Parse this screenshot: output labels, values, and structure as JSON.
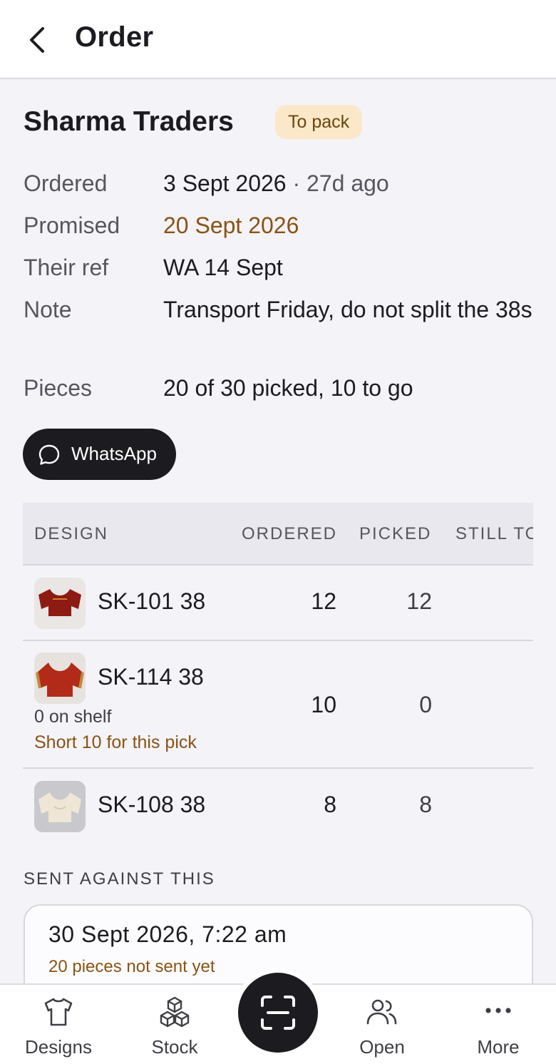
{
  "header": {
    "title": "Order"
  },
  "order": {
    "customer": "Sharma Traders",
    "status": "To pack",
    "ordered_label": "Ordered",
    "ordered_date": "3 Sept 2026",
    "ordered_ago": "· 27d ago",
    "promised_label": "Promised",
    "promised_date": "20 Sept 2026",
    "ref_label": "Their ref",
    "ref_value": "WA 14 Sept",
    "note_label": "Note",
    "note_value": "Transport Friday, do not split the 38s",
    "pieces_label": "Pieces",
    "pieces_value": "20 of 30 picked, 10 to go",
    "whatsapp_label": "WhatsApp"
  },
  "table": {
    "headers": [
      "DESIGN",
      "ORDERED",
      "PICKED",
      "STILL TO"
    ],
    "rows": [
      {
        "design": "SK-101 38",
        "ordered": "12",
        "picked": "12",
        "thumb_color": "#8e1a14"
      },
      {
        "design": "SK-114 38",
        "ordered": "10",
        "picked": "0",
        "shelf": "0 on shelf",
        "short": "Short 10 for this pick",
        "thumb_color": "#b22a18"
      },
      {
        "design": "SK-108 38",
        "ordered": "8",
        "picked": "8",
        "thumb_color": "#efe6d6"
      }
    ]
  },
  "sent": {
    "title": "SENT AGAINST THIS",
    "date": "30 Sept 2026, 7:22 am",
    "note": "20 pieces not sent yet"
  },
  "nav": {
    "designs": "Designs",
    "stock": "Stock",
    "open": "Open",
    "more": "More"
  },
  "colors": {
    "accent_dark": "#1c1b20",
    "badge_bg": "#fbe8c8",
    "warning_text": "#8a5314"
  }
}
